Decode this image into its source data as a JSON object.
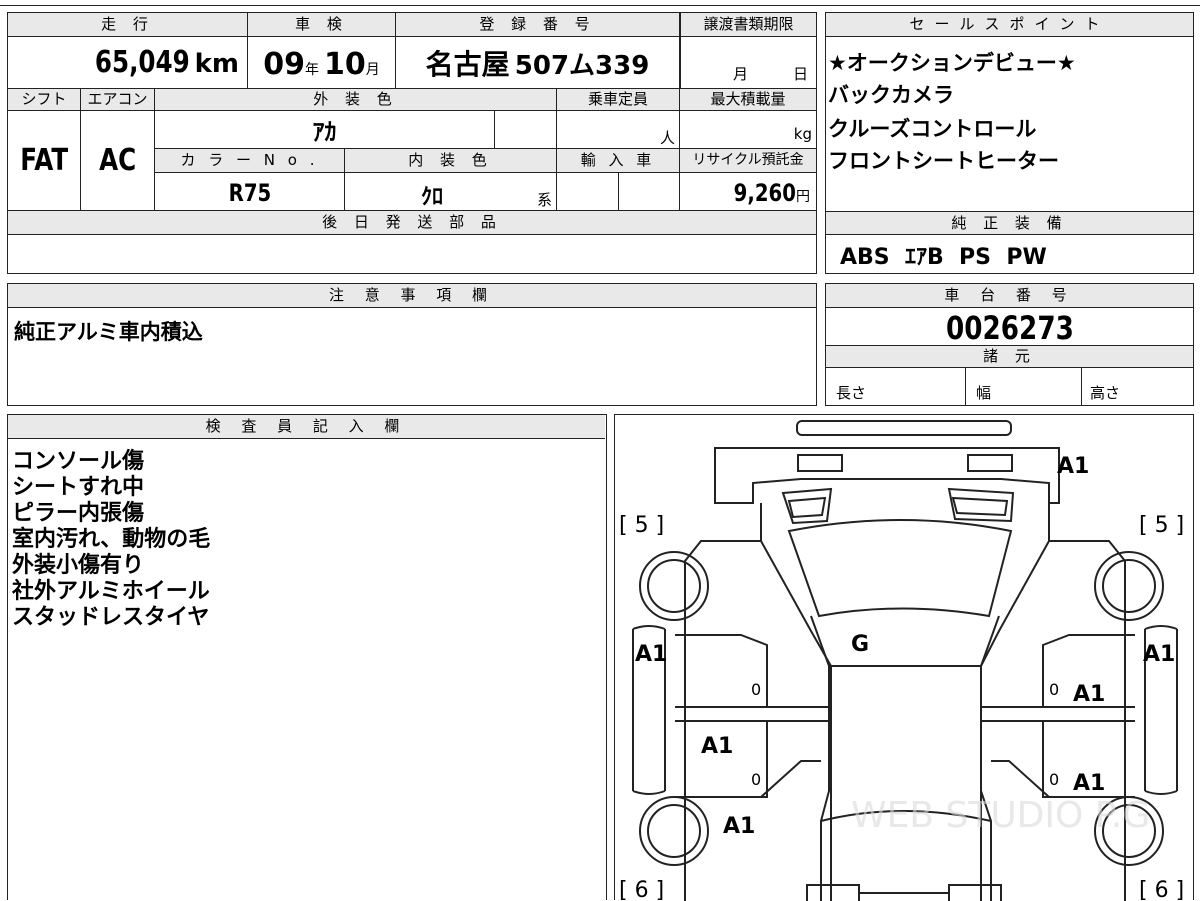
{
  "top_table": {
    "mileage_label": "走 行",
    "mileage_value": "65,049",
    "mileage_unit": "km",
    "inspection_label": "車 検",
    "inspection_year": "09",
    "inspection_year_unit": "年",
    "inspection_month": "10",
    "inspection_month_unit": "月",
    "registration_label": "登 録 番 号",
    "registration_city": "名古屋",
    "registration_number": "507ム339",
    "transfer_label": "譲渡書類期限",
    "transfer_month_unit": "月",
    "transfer_day_unit": "日",
    "shift_label": "シフト",
    "shift_value": "FAT",
    "ac_label": "エアコン",
    "ac_value": "AC",
    "exterior_color_label": "外 装 色",
    "exterior_color_value": "ｱｶ",
    "capacity_label": "乗車定員",
    "capacity_unit": "人",
    "max_load_label": "最大積載量",
    "max_load_unit": "kg",
    "color_no_label": "カ ラ ー N o .",
    "color_no_value": "R75",
    "interior_color_label": "内 装 色",
    "interior_color_value": "ｸﾛ",
    "interior_color_suffix": "系",
    "import_label": "輸 入 車",
    "recycle_label": "リサイクル預託金",
    "recycle_value": "9,260",
    "recycle_unit": "円",
    "later_parts_label": "後 日 発 送 部 品",
    "later_parts_value": ""
  },
  "sales_points": {
    "label": "セールスポイント",
    "items": [
      "★オークションデビュー★",
      "バックカメラ",
      "クルーズコントロール",
      "フロントシートヒーター"
    ]
  },
  "genuine_equipment": {
    "label": "純 正 装 備",
    "value": "ABS  ｴｱB  PS  PW"
  },
  "notes": {
    "label": "注 意 事 項 欄",
    "value": "純正アルミ車内積込"
  },
  "chassis": {
    "label": "車 台 番 号",
    "value": "0026273",
    "specs_label": "諸 元",
    "length_label": "長さ",
    "width_label": "幅",
    "height_label": "高さ"
  },
  "inspector": {
    "label": "検 査 員 記 入 欄",
    "lines": [
      "コンソール傷",
      "シートすれ中",
      "ピラー内張傷",
      "室内汚れ、動物の毛",
      "外装小傷有り",
      "社外アルミホイール",
      "スタッドレスタイヤ"
    ]
  },
  "diagram": {
    "tire_front_left": "[ 5 ]",
    "tire_front_right": "[ 5 ]",
    "tire_rear_left": "[ 6 ]",
    "tire_rear_right": "[ 6 ]",
    "mark_hood_right": "A1",
    "mark_windshield": "G",
    "mark_left_front_fender": "A1",
    "mark_right_front_fender": "A1",
    "mark_right_front_door": "A1",
    "mark_left_rear_door": "A1",
    "mark_right_rear_door": "A1",
    "mark_left_quarter": "A1",
    "door_zero_1": "0",
    "door_zero_2": "0",
    "door_zero_3": "0",
    "door_zero_4": "0",
    "watermark": "WEB STUDIO P.G"
  }
}
